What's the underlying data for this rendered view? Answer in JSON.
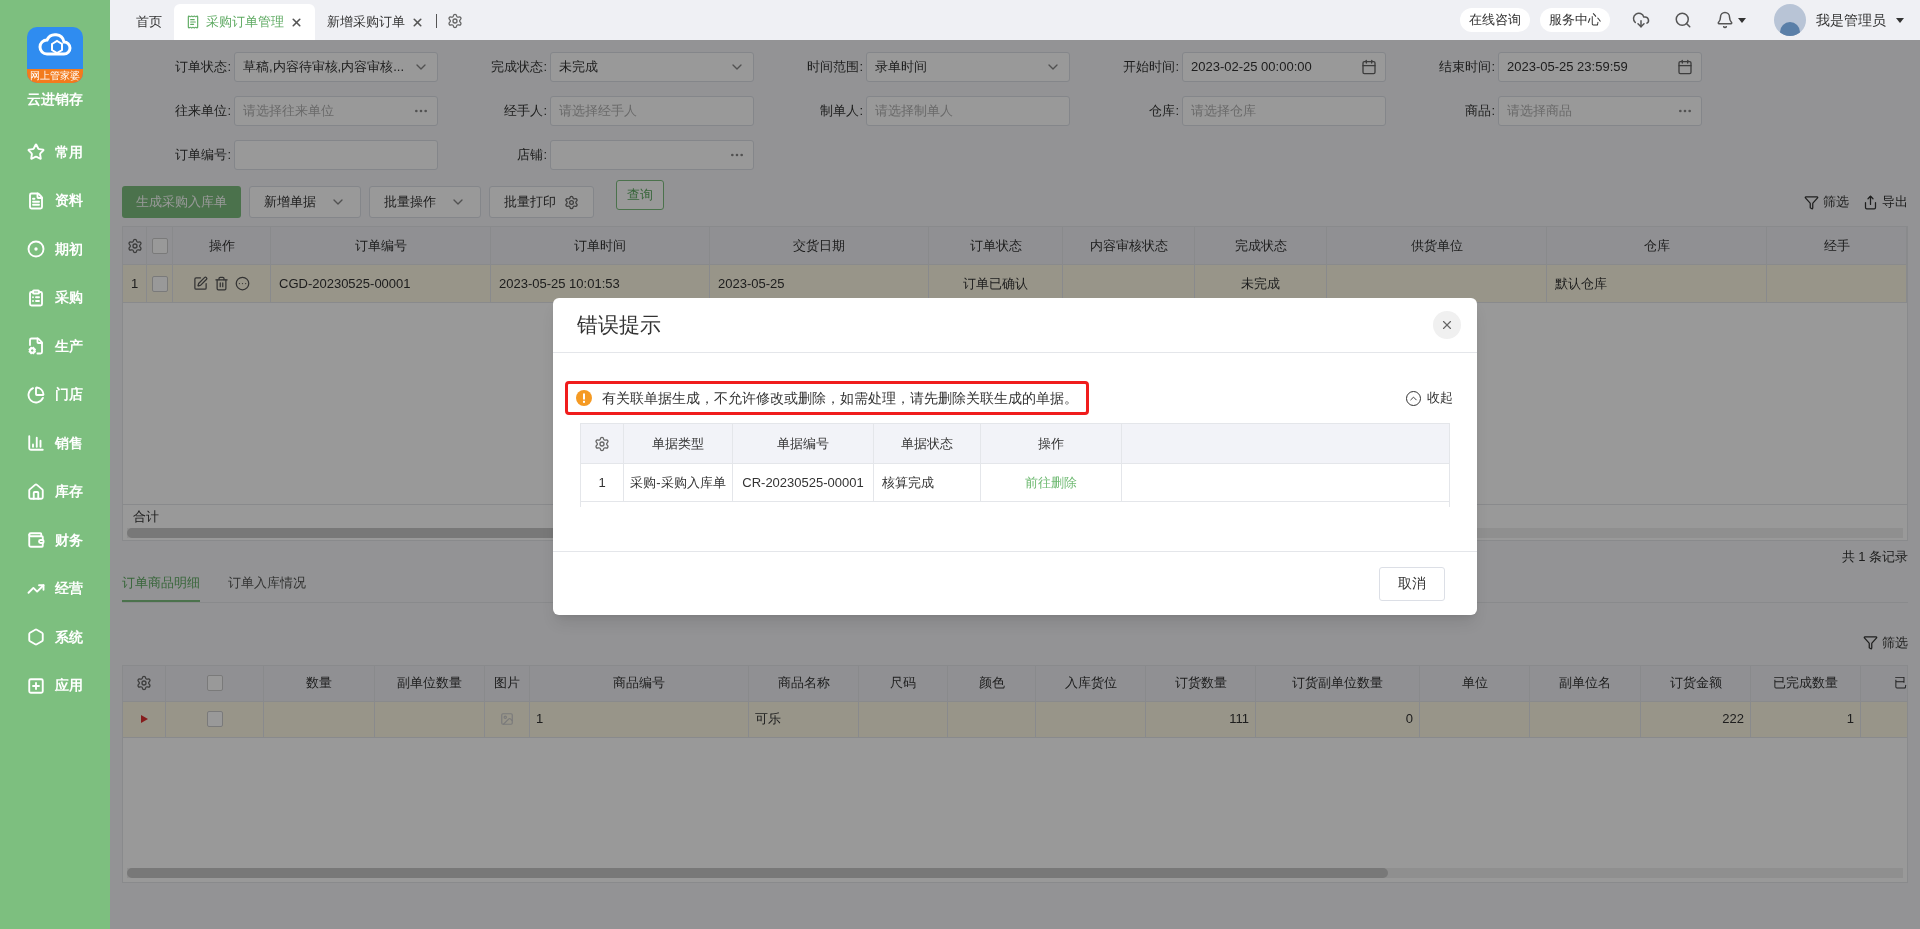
{
  "sidebar": {
    "logo_badge": "网上管家婆",
    "app_name": "云进销存",
    "items": [
      {
        "label": "常用"
      },
      {
        "label": "资料"
      },
      {
        "label": "期初"
      },
      {
        "label": "采购"
      },
      {
        "label": "生产"
      },
      {
        "label": "门店"
      },
      {
        "label": "销售"
      },
      {
        "label": "库存"
      },
      {
        "label": "财务"
      },
      {
        "label": "经营"
      },
      {
        "label": "系统"
      },
      {
        "label": "应用"
      }
    ]
  },
  "tabs": [
    {
      "label": "首页",
      "selected": false,
      "closable": false
    },
    {
      "label": "采购订单管理",
      "selected": true,
      "closable": true
    },
    {
      "label": "新增采购订单",
      "selected": false,
      "closable": true
    }
  ],
  "header": {
    "buttons": [
      "在线咨询",
      "服务中心"
    ],
    "user": "我是管理员"
  },
  "filters": [
    {
      "label": "订单状态:",
      "kind": "select",
      "value": "草稿,内容待审核,内容审核..."
    },
    {
      "label": "完成状态:",
      "kind": "select",
      "value": "未完成"
    },
    {
      "label": "时间范围:",
      "kind": "select",
      "value": "录单时间"
    },
    {
      "label": "开始时间:",
      "kind": "date",
      "value": "2023-02-25 00:00:00"
    },
    {
      "label": "结束时间:",
      "kind": "date",
      "value": "2023-05-25 23:59:59"
    },
    {
      "label": "往来单位:",
      "kind": "picker",
      "placeholder": "请选择往来单位"
    },
    {
      "label": "经手人:",
      "kind": "text",
      "placeholder": "请选择经手人"
    },
    {
      "label": "制单人:",
      "kind": "text",
      "placeholder": "请选择制单人"
    },
    {
      "label": "仓库:",
      "kind": "text",
      "placeholder": "请选择仓库"
    },
    {
      "label": "商品:",
      "kind": "picker",
      "placeholder": "请选择商品"
    },
    {
      "label": "订单编号:",
      "kind": "text"
    },
    {
      "label": "店铺:",
      "kind": "picker"
    }
  ],
  "query_button": "查询",
  "toolbar": {
    "primary": "生成采购入库单",
    "dropdowns": [
      "新增单据",
      "批量操作"
    ],
    "print": "批量打印",
    "filter": "筛选",
    "export": "导出"
  },
  "orders": {
    "columns": [
      "操作",
      "订单编号",
      "订单时间",
      "交货日期",
      "订单状态",
      "内容审核状态",
      "完成状态",
      "供货单位",
      "仓库",
      "经手"
    ],
    "all_checked": false,
    "rows": [
      {
        "index": "1",
        "checked": false,
        "cells": [
          "",
          "CGD-20230525-00001",
          "2023-05-25 10:01:53",
          "2023-05-25",
          "订单已确认",
          "",
          "未完成",
          "",
          "默认仓库",
          ""
        ]
      }
    ],
    "footer_label": "合计",
    "record_count": "共 1 条记录"
  },
  "detail_tabs": [
    {
      "label": "订单商品明细",
      "selected": true
    },
    {
      "label": "订单入库情况",
      "selected": false
    }
  ],
  "detail": {
    "filter": "筛选",
    "columns": [
      "数量",
      "副单位数量",
      "图片",
      "商品编号",
      "商品名称",
      "尺码",
      "颜色",
      "入库货位",
      "订货数量",
      "订货副单位数量",
      "单位",
      "副单位名",
      "订货金额",
      "已完成数量",
      "已"
    ],
    "all_checked": false,
    "rows": [
      {
        "checked": false,
        "cells": [
          "",
          "",
          "",
          "1",
          "可乐",
          "",
          "",
          "",
          "111",
          "0",
          "",
          "",
          "222",
          "1",
          ""
        ]
      }
    ]
  },
  "dialog": {
    "title": "错误提示",
    "message": "有关联单据生成，不允许修改或删除，如需处理，请先删除关联生成的单据。",
    "collapse": "收起",
    "columns": [
      "单据类型",
      "单据编号",
      "单据状态",
      "操作"
    ],
    "rows": [
      {
        "index": "1",
        "type": "采购-采购入库单",
        "number": "CR-20230525-00001",
        "status": "核算完成",
        "action": "前往删除"
      }
    ],
    "cancel": "取消"
  }
}
